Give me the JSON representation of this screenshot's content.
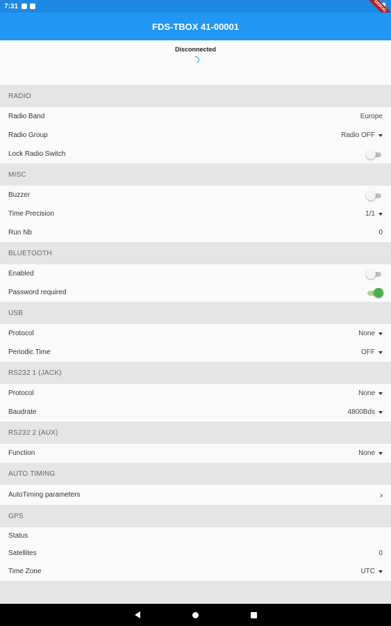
{
  "status_bar": {
    "time": "7:31",
    "debug_label": "DEBUG"
  },
  "app_bar": {
    "title": "FDS-TBOX 41-00001"
  },
  "connection": {
    "status": "Disconnected"
  },
  "sections": {
    "radio": {
      "header": "RADIO",
      "radio_band": {
        "label": "Radio Band",
        "value": "Europe"
      },
      "radio_group": {
        "label": "Radio Group",
        "value": "Radio OFF"
      },
      "lock_radio_switch": {
        "label": "Lock Radio Switch",
        "on": false
      }
    },
    "misc": {
      "header": "MISC",
      "buzzer": {
        "label": "Buzzer",
        "on": false
      },
      "time_precision": {
        "label": "Time Precision",
        "value": "1/1"
      },
      "run_nb": {
        "label": "Run Nb",
        "value": "0"
      }
    },
    "bluetooth": {
      "header": "BLUETOOTH",
      "enabled": {
        "label": "Enabled",
        "on": false
      },
      "password_required": {
        "label": "Password required",
        "on": true
      }
    },
    "usb": {
      "header": "USB",
      "protocol": {
        "label": "Protocol",
        "value": "None"
      },
      "periodic_time": {
        "label": "Periodic Time",
        "value": "OFF"
      }
    },
    "rs232_1": {
      "header": "RS232 1 (JACK)",
      "protocol": {
        "label": "Protocol",
        "value": "None"
      },
      "baudrate": {
        "label": "Baudrate",
        "value": "4800Bds"
      }
    },
    "rs232_2": {
      "header": "RS232 2 (AUX)",
      "function": {
        "label": "Function",
        "value": "None"
      }
    },
    "auto_timing": {
      "header": "AUTO TIMING",
      "parameters": {
        "label": "AutoTiming parameters"
      }
    },
    "gps": {
      "header": "GPS",
      "status": {
        "label": "Status",
        "value": ""
      },
      "satellites": {
        "label": "Satellites",
        "value": "0"
      },
      "time_zone": {
        "label": "Time Zone",
        "value": "UTC"
      }
    }
  },
  "colors": {
    "app_bar": "#2196f3",
    "status_bar": "#1e88e5",
    "toggle_on": "#4caf50",
    "section_bg": "#e5e5e5"
  }
}
